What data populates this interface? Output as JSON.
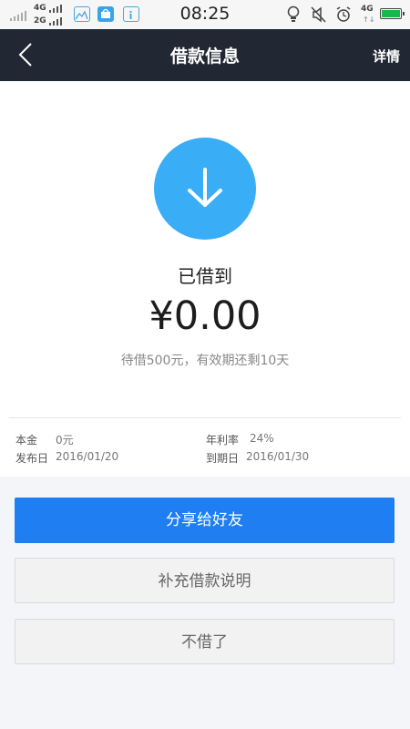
{
  "status_bar": {
    "time": "08:25",
    "net_top": "4G",
    "net_bottom": "2G",
    "net_right": "4G",
    "battery_color": "#19b849"
  },
  "nav": {
    "title": "借款信息",
    "detail_label": "详情",
    "back_icon": "chevron-left-icon",
    "background": "#222833"
  },
  "loan": {
    "status": "已借到",
    "amount": "¥0.00",
    "note": "待借500元，有效期还剩10天",
    "icon": "arrow-down-icon",
    "icon_color": "#39adf6"
  },
  "info": {
    "principal_label": "本金",
    "principal_value": "0元",
    "rate_label": "年利率",
    "rate_value": "24%",
    "publish_label": "发布日",
    "publish_value": "2016/01/20",
    "due_label": "到期日",
    "due_value": "2016/01/30"
  },
  "buttons": {
    "share": "分享给好友",
    "supplement": "补充借款说明",
    "cancel": "不借了",
    "primary_color": "#1e7ef2"
  }
}
